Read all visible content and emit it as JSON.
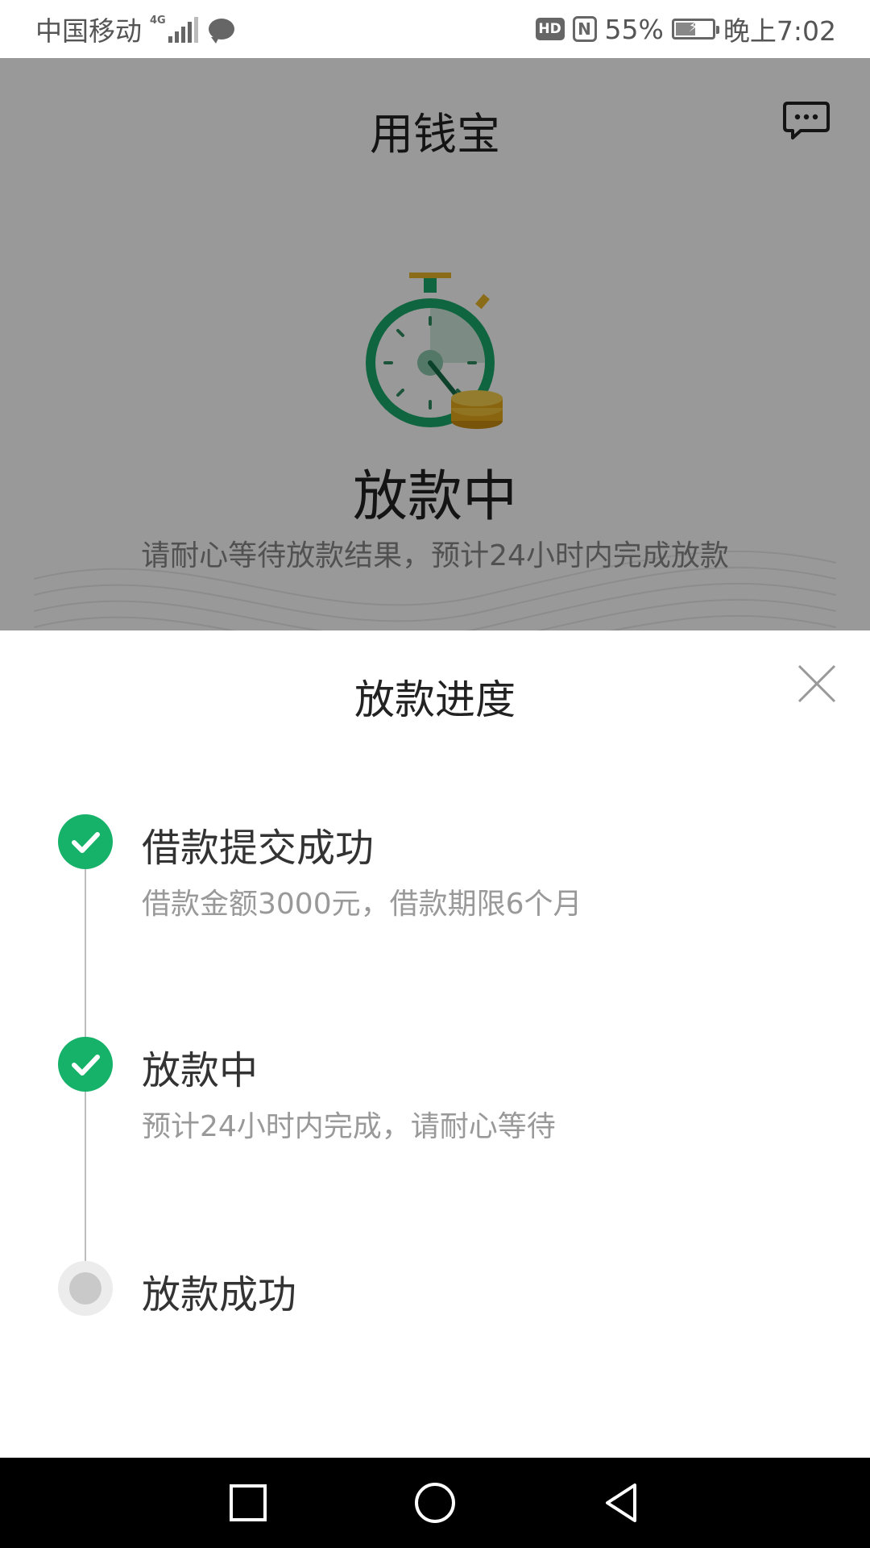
{
  "status_bar": {
    "carrier": "中国移动",
    "network": "4G",
    "hd_label": "HD",
    "nfc_label": "N",
    "battery": "55%",
    "battery_level": 0.55,
    "time": "晚上7:02"
  },
  "header": {
    "title": "用钱宝"
  },
  "status_card": {
    "status": "放款中",
    "note": "请耐心等待放款结果，预计24小时内完成放款"
  },
  "sheet": {
    "title": "放款进度",
    "steps": [
      {
        "title": "借款提交成功",
        "desc": "借款金额3000元，借款期限6个月",
        "state": "done"
      },
      {
        "title": "放款中",
        "desc": "预计24小时内完成，请耐心等待",
        "state": "done"
      },
      {
        "title": "放款成功",
        "desc": "",
        "state": "pending"
      }
    ]
  },
  "colors": {
    "accent": "#16b26a",
    "pending_dot": "#c9c9c9",
    "overlay": "rgba(0,0,0,0.40)"
  },
  "icons": {
    "message": "chat-message-icon",
    "close": "close-icon",
    "check": "check-icon",
    "nav_recents": "square-icon",
    "nav_home": "circle-icon",
    "nav_back": "triangle-back-icon"
  }
}
